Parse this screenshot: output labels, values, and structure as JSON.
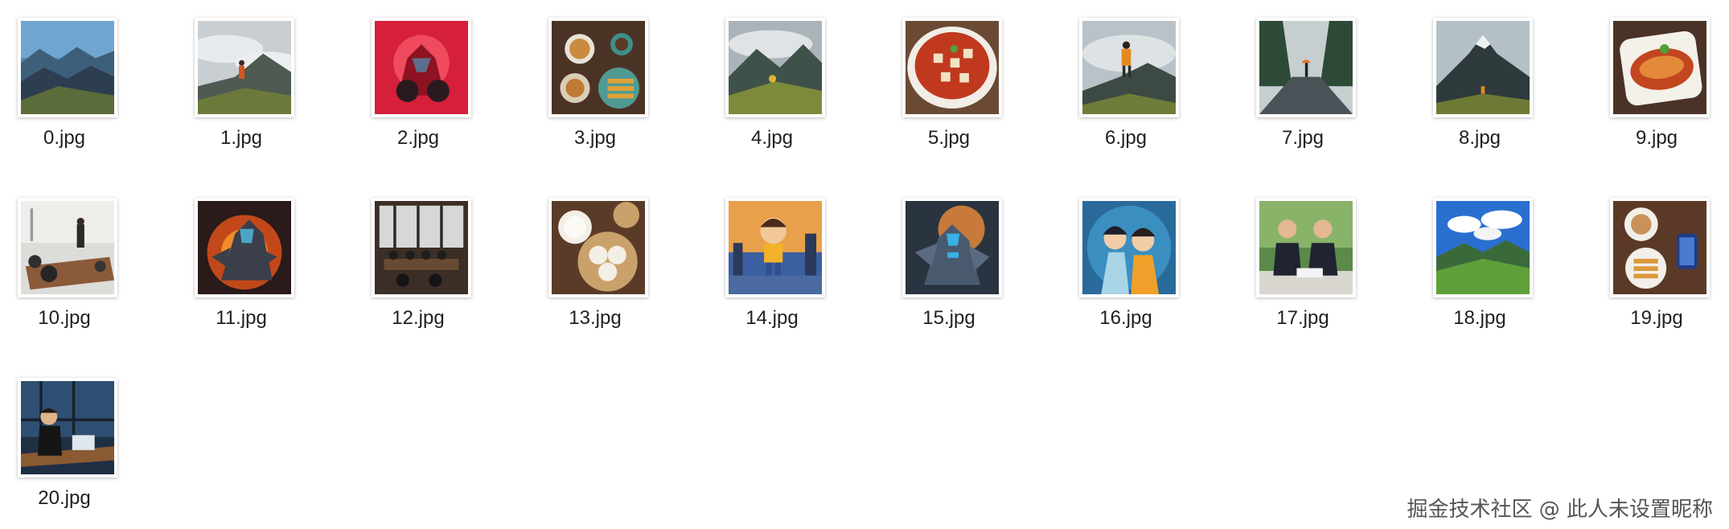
{
  "files": [
    {
      "name": "0.jpg",
      "scene": "mountain-valley-icon"
    },
    {
      "name": "1.jpg",
      "scene": "hiker-mountain-icon"
    },
    {
      "name": "2.jpg",
      "scene": "red-mecha-icon"
    },
    {
      "name": "3.jpg",
      "scene": "breakfast-table-icon"
    },
    {
      "name": "4.jpg",
      "scene": "mountain-path-icon"
    },
    {
      "name": "5.jpg",
      "scene": "mapo-tofu-icon"
    },
    {
      "name": "6.jpg",
      "scene": "hiker-summit-icon"
    },
    {
      "name": "7.jpg",
      "scene": "rainy-forest-road-icon"
    },
    {
      "name": "8.jpg",
      "scene": "hiker-peak-icon"
    },
    {
      "name": "9.jpg",
      "scene": "fish-dish-icon"
    },
    {
      "name": "10.jpg",
      "scene": "meeting-room-icon"
    },
    {
      "name": "11.jpg",
      "scene": "fire-mecha-icon"
    },
    {
      "name": "12.jpg",
      "scene": "conference-hall-icon"
    },
    {
      "name": "13.jpg",
      "scene": "dumplings-icon"
    },
    {
      "name": "14.jpg",
      "scene": "cartoon-boy-icon"
    },
    {
      "name": "15.jpg",
      "scene": "blue-mecha-icon"
    },
    {
      "name": "16.jpg",
      "scene": "anime-boys-icon"
    },
    {
      "name": "17.jpg",
      "scene": "business-men-icon"
    },
    {
      "name": "18.jpg",
      "scene": "green-valley-icon"
    },
    {
      "name": "19.jpg",
      "scene": "coffee-churros-icon"
    },
    {
      "name": "20.jpg",
      "scene": "laptop-worker-icon"
    }
  ],
  "watermark": "掘金技术社区 @ 此人未设置昵称"
}
